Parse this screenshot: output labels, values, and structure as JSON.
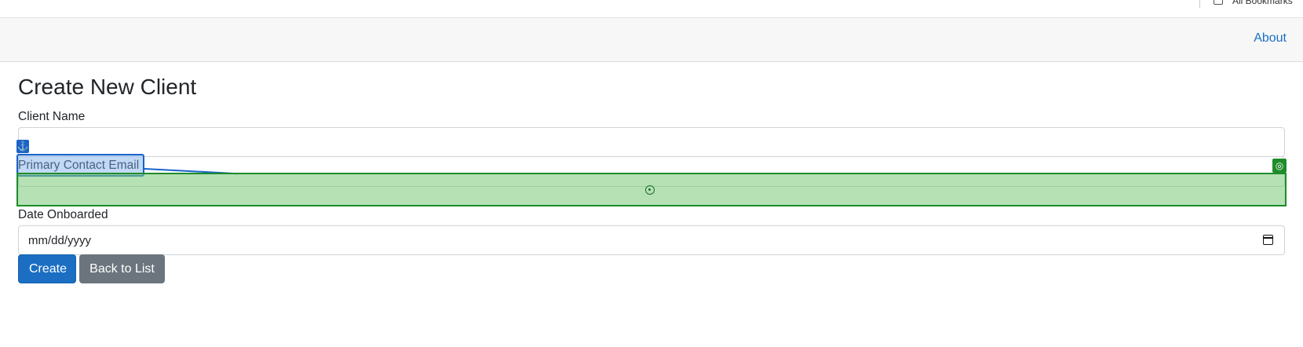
{
  "browser": {
    "bookmarks_label": "All Bookmarks",
    "bookmarks_icon": "folder-icon"
  },
  "navbar": {
    "about_link": "About"
  },
  "form": {
    "title": "Create New Client",
    "client_name_label": "Client Name",
    "client_name_value": "",
    "email_label": "Primary Contact Email",
    "email_value": "",
    "date_label": "Date Onboarded",
    "date_placeholder": "mm/dd/yyyy",
    "date_icon": "calendar-icon",
    "create_button": "Create",
    "back_button": "Back to List"
  },
  "overlay": {
    "anchor_glyph": "⚓",
    "target_glyph": "◎",
    "label_color": "#1a63c9",
    "target_color": "#1f8c2a"
  },
  "colors": {
    "primary": "#1b6ec2",
    "secondary": "#6c757d",
    "link": "#1a6fc4"
  }
}
